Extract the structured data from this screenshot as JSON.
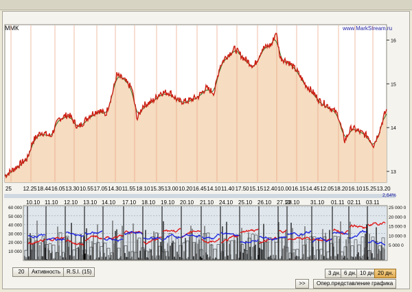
{
  "window": {
    "ticker": "ММК",
    "site": "www.MarkStream.ru"
  },
  "colors": {
    "price_line": "#cc1f14",
    "ma_line": "#2e6b1e",
    "fill": "#f6dcc0",
    "volume_red": "#e01010",
    "volume_blue": "#1820e0",
    "grid_bg": "#dfe6ec"
  },
  "price_panel": {
    "y_ticks": [
      "16",
      "15",
      "14",
      "13"
    ],
    "x_ticks": [
      "25",
      "12.25",
      "18.44",
      "16.05",
      "13.30",
      "10.55",
      "17.05",
      "14.30",
      "11.55",
      "18.10",
      "15.35",
      "13.00",
      "10.20",
      "16.45",
      "14.10",
      "11.40",
      "17.50",
      "15.15",
      "12.40",
      "10.00",
      "16.15",
      "14.45",
      "12.05",
      "18.20",
      "16.10",
      "15.25",
      "13.20"
    ],
    "change_label": "2,64%"
  },
  "volume_panel": {
    "date_labels": [
      "10.10",
      "11.10",
      "12.10",
      "13.10",
      "14.10",
      "17.10",
      "18.10",
      "19.10",
      "20.10",
      "21.10",
      "24.10",
      "25.10",
      "26.10",
      "27.10",
      "28.10",
      "31.10",
      "01.11",
      "02.11",
      "03.11"
    ],
    "left_ticks": [
      "60 000",
      "50 000",
      "40 000",
      "30 000",
      "20 000",
      "10 000"
    ],
    "right_ticks": [
      "25 000 0",
      "20 000 0",
      "15 000 0",
      "10 000 0",
      "5 000 0"
    ]
  },
  "toolbar": {
    "period_value": "20",
    "activity_label": "Активность",
    "rsi_label": "R.S.I. (15)",
    "range_3d": "3 дн.",
    "range_6d": "6 дн.",
    "range_10d": "10 дн.",
    "range_20d": "20 дн.",
    "next_label": ">>",
    "chart_view_label": "Опер.представление графика"
  }
}
